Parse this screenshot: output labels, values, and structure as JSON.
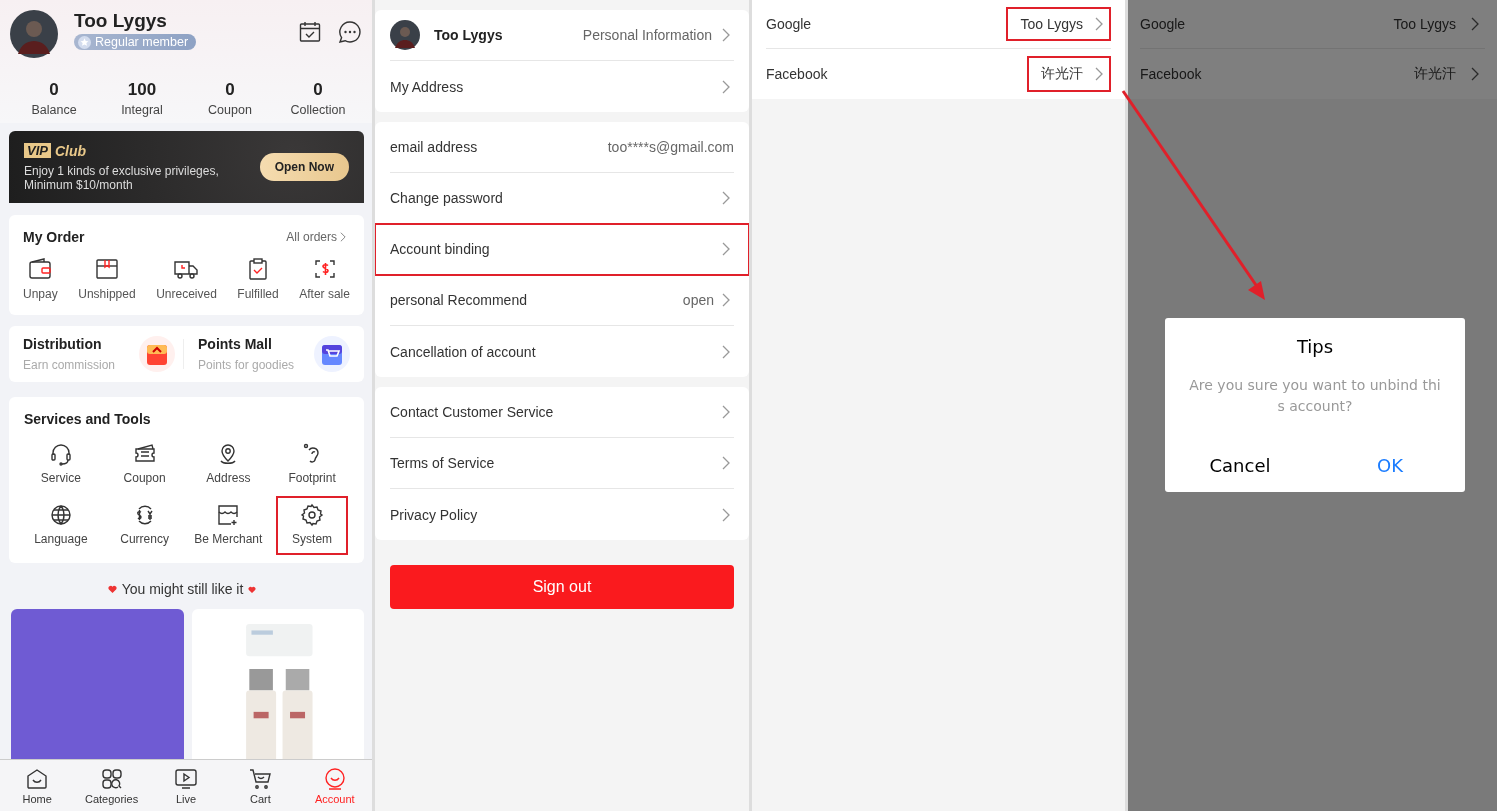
{
  "account": {
    "profile": {
      "name": "Too Lygys",
      "badge": "Regular member"
    },
    "stats": [
      {
        "value": "0",
        "label": "Balance"
      },
      {
        "value": "100",
        "label": "Integral"
      },
      {
        "value": "0",
        "label": "Coupon"
      },
      {
        "value": "0",
        "label": "Collection"
      }
    ],
    "vip": {
      "badge": "VIP",
      "title": "Club",
      "text": "Enjoy 1 kinds of exclusive privileges, Minimum $10/month",
      "button": "Open Now"
    },
    "order": {
      "title": "My Order",
      "link": "All orders",
      "items": [
        {
          "label": "Unpay"
        },
        {
          "label": "Unshipped"
        },
        {
          "label": "Unreceived"
        },
        {
          "label": "Fulfilled"
        },
        {
          "label": "After sale"
        }
      ]
    },
    "promos": [
      {
        "title": "Distribution",
        "subtitle": "Earn commission"
      },
      {
        "title": "Points Mall",
        "subtitle": "Points for goodies"
      }
    ],
    "services": {
      "title": "Services and Tools",
      "items": [
        {
          "label": "Service",
          "highlighted": false
        },
        {
          "label": "Coupon",
          "highlighted": false
        },
        {
          "label": "Address",
          "highlighted": false
        },
        {
          "label": "Footprint",
          "highlighted": false
        },
        {
          "label": "Language",
          "highlighted": false
        },
        {
          "label": "Currency",
          "highlighted": false
        },
        {
          "label": "Be Merchant",
          "highlighted": false
        },
        {
          "label": "System",
          "highlighted": true
        }
      ]
    },
    "recommend": {
      "title": "You might still like it",
      "products": [
        {
          "kind": "placeholder"
        },
        {
          "kind": "picture"
        }
      ]
    },
    "tabbar": [
      {
        "label": "Home",
        "selected": false
      },
      {
        "label": "Categories",
        "selected": false
      },
      {
        "label": "Live",
        "selected": false
      },
      {
        "label": "Cart",
        "selected": false
      },
      {
        "label": "Account",
        "selected": true
      }
    ]
  },
  "settings": {
    "profile": {
      "name": "Too Lygys",
      "link": "Personal Information"
    },
    "groups": [
      [
        {
          "label": "My Address",
          "highlighted": false
        }
      ],
      [
        {
          "label": "email address",
          "value": "too****s@gmail.com",
          "chevron": false,
          "highlighted": false
        },
        {
          "label": "Change password",
          "highlighted": false
        },
        {
          "label": "Account binding",
          "highlighted": true
        },
        {
          "label": "personal Recommend",
          "value": "open",
          "highlighted": false
        },
        {
          "label": "Cancellation of account",
          "highlighted": false
        }
      ],
      [
        {
          "label": "Contact Customer Service",
          "highlighted": false
        },
        {
          "label": "Terms of Service",
          "highlighted": false
        },
        {
          "label": "Privacy Policy",
          "highlighted": false
        }
      ]
    ],
    "sign_out": "Sign out"
  },
  "binding": {
    "rows": [
      {
        "label": "Google",
        "value": "Too Lygys",
        "highlighted": true
      },
      {
        "label": "Facebook",
        "value": "许光汗",
        "highlighted": true
      }
    ]
  },
  "binding_dialog": {
    "rows": [
      {
        "label": "Google",
        "value": "Too Lygys"
      },
      {
        "label": "Facebook",
        "value": "许光汗"
      }
    ],
    "dialog": {
      "title": "Tips",
      "message": "Are you sure you want to unbind this account?",
      "cancel": "Cancel",
      "ok": "OK"
    }
  }
}
